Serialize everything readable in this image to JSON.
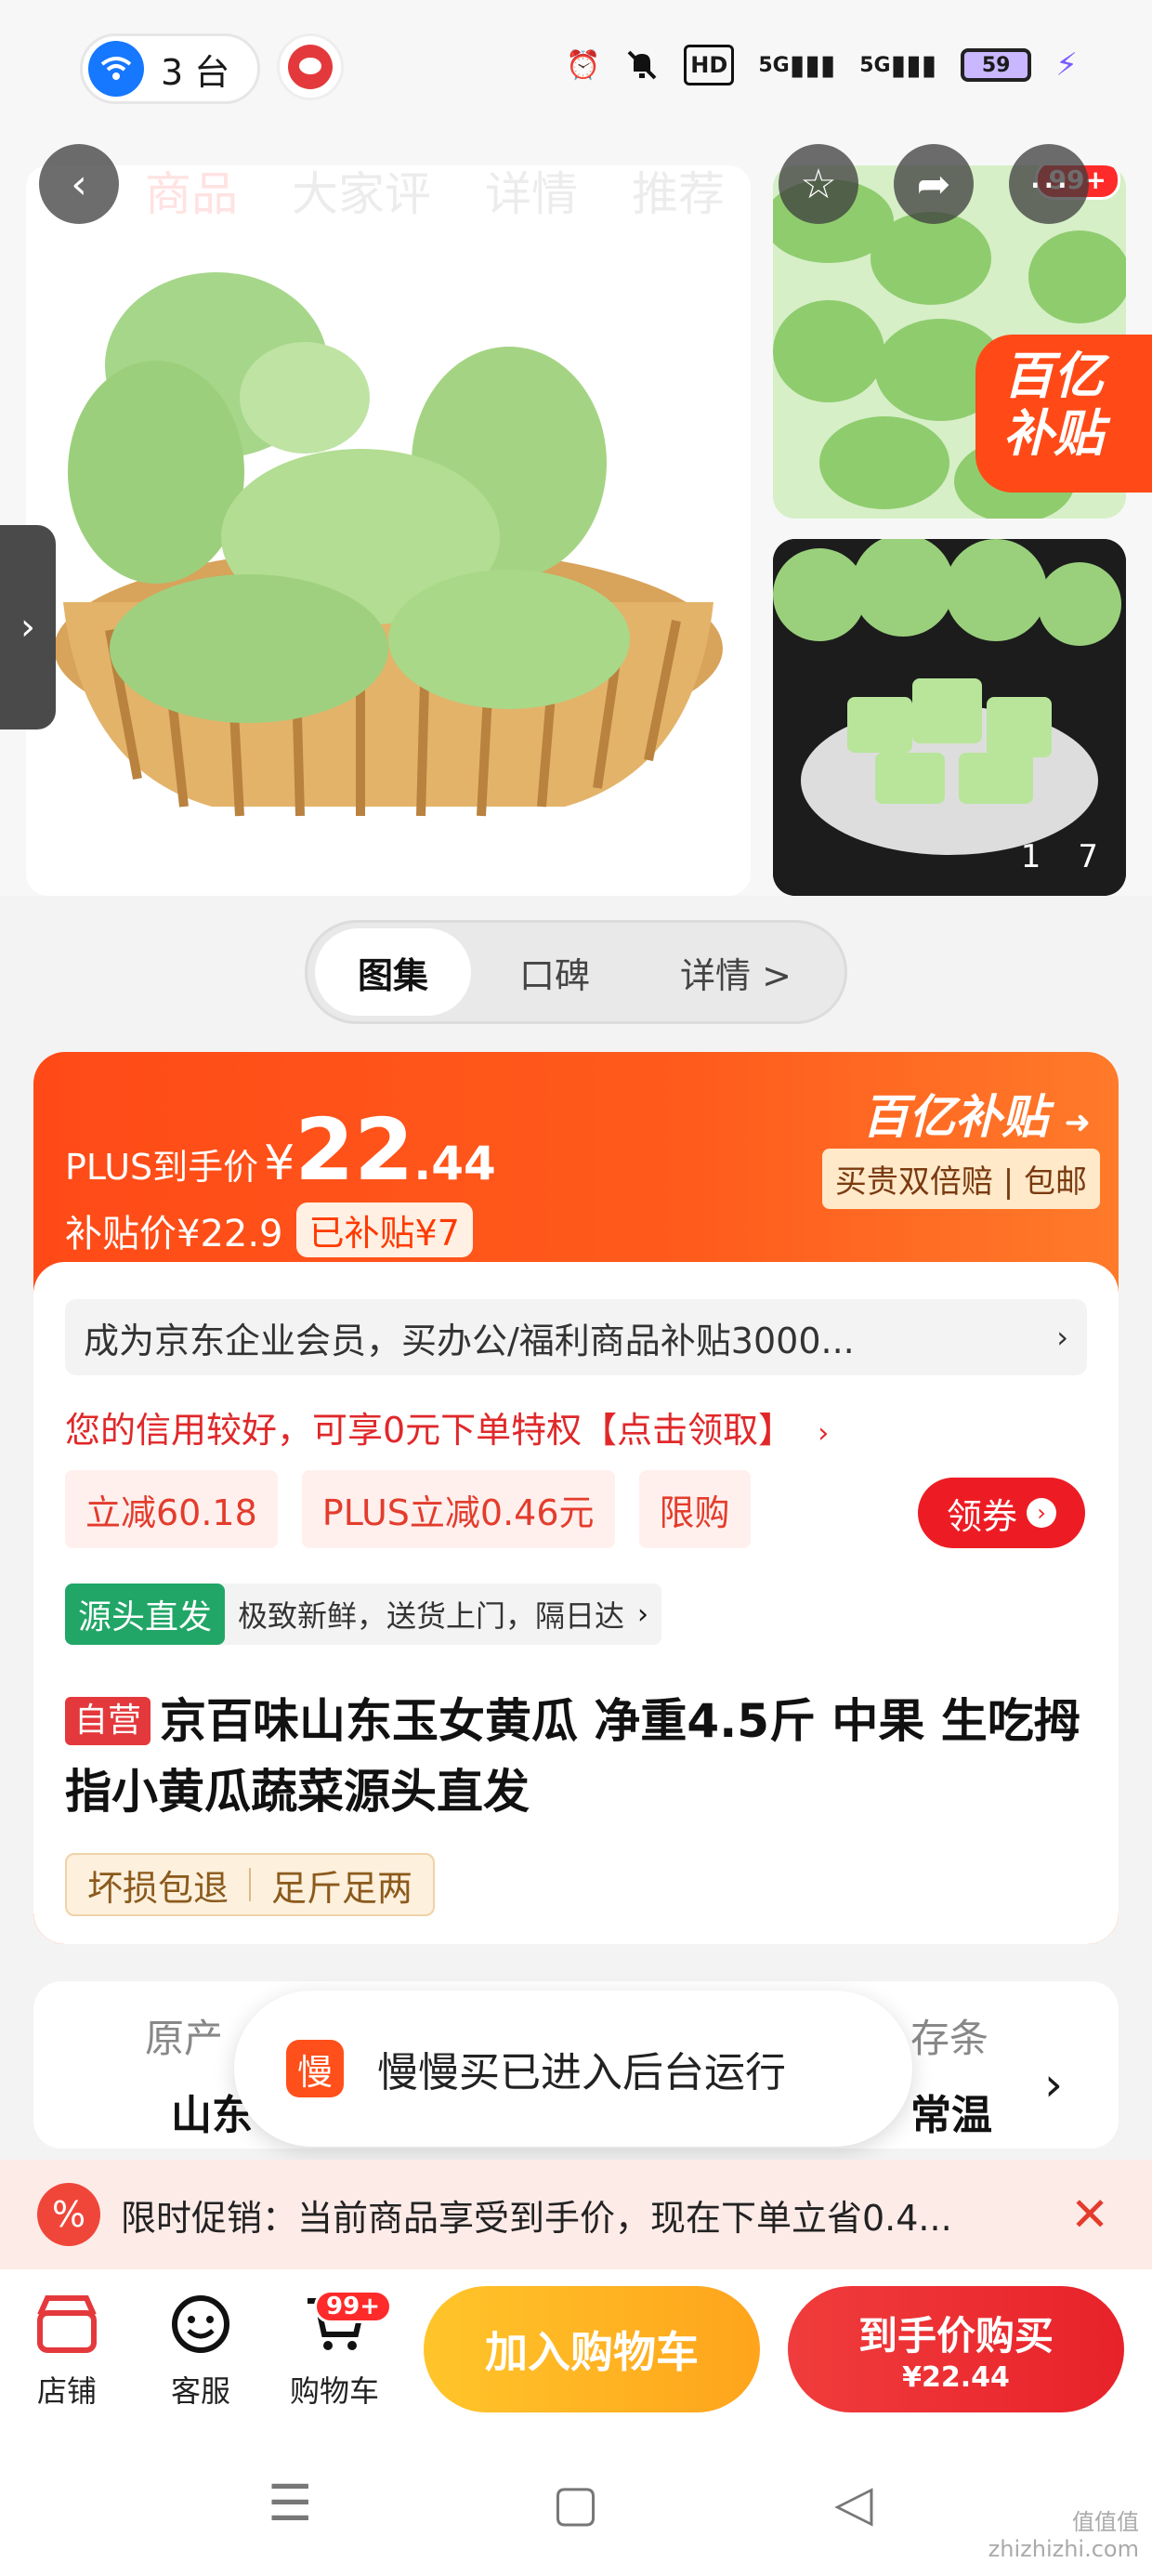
{
  "status_bar": {
    "device_count": "3 台",
    "signal1": "5G",
    "signal2": "5G",
    "hd": "HD",
    "battery": "59"
  },
  "top_nav": {
    "tabs": [
      "商品",
      "大家评",
      "详情",
      "推荐"
    ],
    "cart_badge": "99+"
  },
  "gallery": {
    "yi_corner": "百亿\n补贴",
    "count_current": "1",
    "count_total": "7"
  },
  "segment": {
    "tabs": [
      "图集",
      "口碑",
      "详情 >"
    ]
  },
  "price": {
    "plus_label": "PLUS到手价",
    "yen": "¥",
    "int": "22",
    "dec": ".44",
    "subsidy_label": "补贴价¥22.9",
    "subsidy_tag": "已补贴¥7",
    "yi_logo": "百亿补贴",
    "yi_sub": "买贵双倍赔 | 包邮"
  },
  "enterprise": "成为京东企业会员，买办公/福利商品补贴3000...",
  "credit": "您的信用较好，可享0元下单特权【点击领取】",
  "promos": [
    "立减60.18",
    "PLUS立减0.46元",
    "限购"
  ],
  "coupon": "领券",
  "source": {
    "tag": "源头直发",
    "text": "极致新鲜，送货上门，隔日达"
  },
  "product": {
    "self_tag": "自营",
    "title": "京百味山东玉女黄瓜 净重4.5斤 中果 生吃拇指小黄瓜蔬菜源头直发"
  },
  "guarantees": [
    "坏损包退",
    "足斤足两"
  ],
  "specs": {
    "origin_label": "原产",
    "origin_value": "山东",
    "storage_label": "存条",
    "storage_value": "常温"
  },
  "toast": {
    "logo": "慢",
    "message": "慢慢买已进入后台运行"
  },
  "promo_banner": "限时促销：当前商品享受到手价，现在下单立省0.4...",
  "bottom_bar": {
    "store": "店铺",
    "service": "客服",
    "cart": "购物车",
    "cart_badge": "99+",
    "add_cart": "加入购物车",
    "buy_now": "到手价购买",
    "buy_price": "¥22.44"
  },
  "watermark": "值值值\nzhizhizhi.com",
  "colors": {
    "accent_red": "#e4393c",
    "subsidy_orange": "#ff4a17",
    "add_cart_yellow": "#ffb21f",
    "source_green": "#21a667"
  }
}
